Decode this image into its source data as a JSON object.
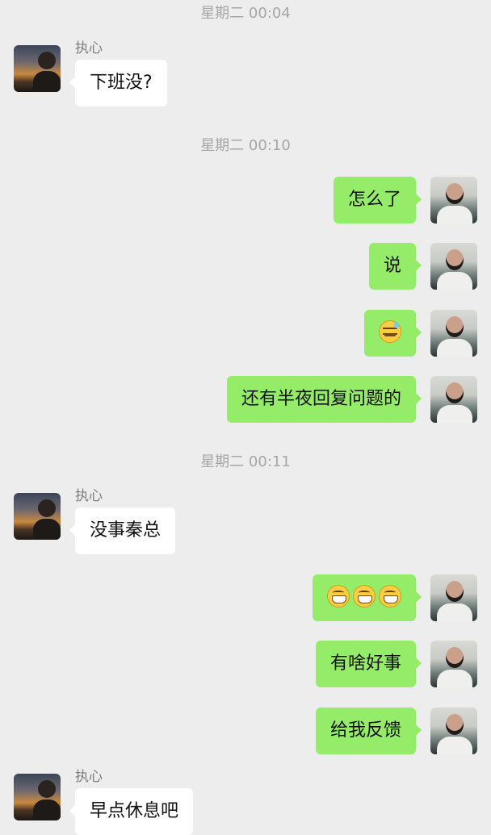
{
  "contact": {
    "name": "执心"
  },
  "timestamps": [
    "星期二 00:04",
    "星期二 00:10",
    "星期二 00:11"
  ],
  "messages": [
    {
      "from": "other",
      "text": "下班没?"
    },
    {
      "from": "self",
      "text": "怎么了"
    },
    {
      "from": "self",
      "text": "说"
    },
    {
      "from": "self",
      "emoji": [
        "sweat-smile-icon"
      ]
    },
    {
      "from": "self",
      "text": "还有半夜回复问题的"
    },
    {
      "from": "other",
      "text": "没事秦总"
    },
    {
      "from": "self",
      "emoji": [
        "grin-icon",
        "grin-icon",
        "grin-icon"
      ]
    },
    {
      "from": "self",
      "text": "有啥好事"
    },
    {
      "from": "self",
      "text": "给我反馈"
    },
    {
      "from": "other",
      "text": "早点休息吧"
    }
  ],
  "colors": {
    "background": "#ededed",
    "self_bubble": "#95ec69",
    "other_bubble": "#ffffff",
    "timestamp": "#a6a6a6"
  }
}
